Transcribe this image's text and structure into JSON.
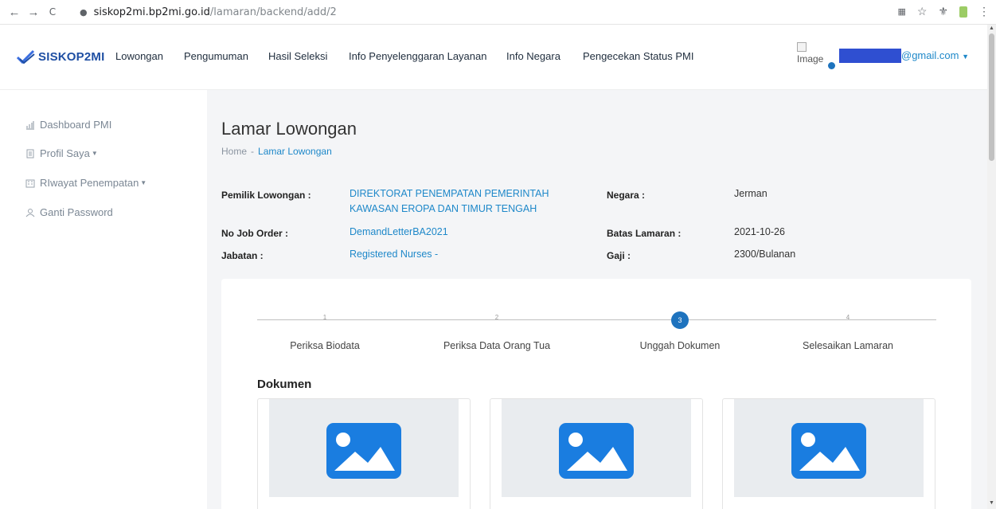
{
  "browser": {
    "back": "←",
    "forward": "→",
    "reload": "C",
    "lock": "🔒",
    "host": "siskop2mi.bp2mi.go.id",
    "path": "/lamaran/backend/add/2",
    "translate_icon": "translate-icon",
    "star": "☆",
    "puzzle": "puzzle-icon",
    "menu": "⋮"
  },
  "header": {
    "logo_text": "SISKOP2MI",
    "menu": [
      "Lowongan",
      "Pengumuman",
      "Hasil Seleksi",
      "Info Penyelenggaran Layanan",
      "Info Negara",
      "Pengecekan Status PMI"
    ],
    "image_alt": "Image",
    "email_suffix": "@gmail.com"
  },
  "sidebar": {
    "items": [
      {
        "label": "Dashboard PMI",
        "icon": "chart-icon"
      },
      {
        "label": "Profil Saya",
        "icon": "document-icon",
        "caret": true
      },
      {
        "label": "RIwayat Penempatan",
        "icon": "building-icon",
        "caret": true
      },
      {
        "label": "Ganti Password",
        "icon": "user-icon"
      }
    ]
  },
  "main": {
    "title": "Lamar Lowongan",
    "breadcrumb": {
      "home": "Home",
      "separator": "-",
      "current": "Lamar Lowongan"
    },
    "info": {
      "pemilik_label": "Pemilik Lowongan :",
      "pemilik_line1": "DIREKTORAT PENEMPATAN PEMERINTAH",
      "pemilik_line2": "KAWASAN EROPA DAN TIMUR TENGAH",
      "job_order_label": "No Job Order :",
      "job_order_value": "DemandLetterBA2021",
      "jabatan_label": "Jabatan :",
      "jabatan_value": "Registered Nurses -",
      "negara_label": "Negara :",
      "negara_value": "Jerman",
      "batas_label": "Batas Lamaran :",
      "batas_value": "2021-10-26",
      "gaji_label": "Gaji :",
      "gaji_value": "2300/Bulanan"
    },
    "steps": [
      {
        "num": "1",
        "label": "Periksa Biodata"
      },
      {
        "num": "2",
        "label": "Periksa Data Orang Tua"
      },
      {
        "num": "3",
        "label": "Unggah Dokumen",
        "active": true
      },
      {
        "num": "4",
        "label": "Selesaikan Lamaran"
      }
    ],
    "section_title": "Dokumen",
    "documents": [
      {
        "icon": "image-icon"
      },
      {
        "icon": "image-icon"
      },
      {
        "icon": "image-icon"
      }
    ]
  },
  "colors": {
    "accent": "#1e73be",
    "brand": "#1f4fa3",
    "link": "#1e88c9",
    "icon_blue": "#1a7de0"
  }
}
